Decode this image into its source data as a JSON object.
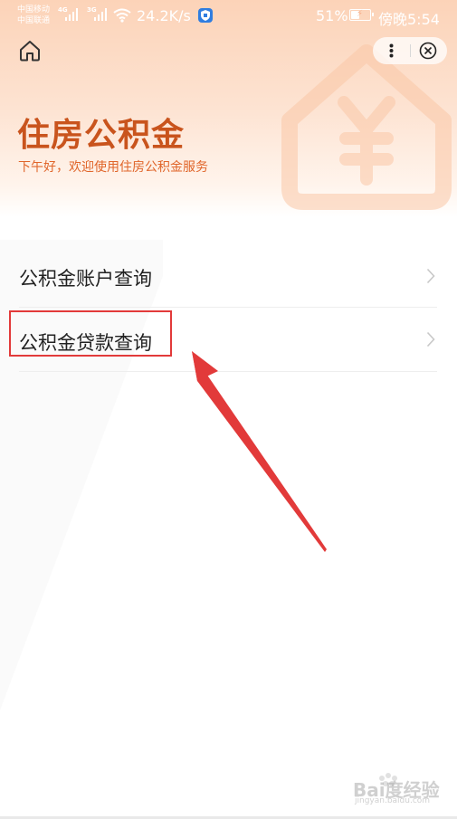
{
  "status_bar": {
    "carrier_1": "中国移动",
    "carrier_2": "中国联通",
    "signal_1_tag": "4G",
    "signal_2_tag": "3G",
    "net_speed": "24.2K/s",
    "battery_percent": "51%",
    "battery_level": 0.51,
    "time": "傍晚5:54"
  },
  "header": {
    "title": "住房公积金",
    "greeting": "下午好，欢迎使用住房公积金服务"
  },
  "menu": {
    "items": [
      {
        "label": "公积金账户查询"
      },
      {
        "label": "公积金贷款查询"
      }
    ]
  },
  "watermark": {
    "text": "Bai度经验",
    "sub": "jingyan.baidu.com"
  },
  "colors": {
    "accent": "#c9541d",
    "annotation": "#e23a3a"
  }
}
